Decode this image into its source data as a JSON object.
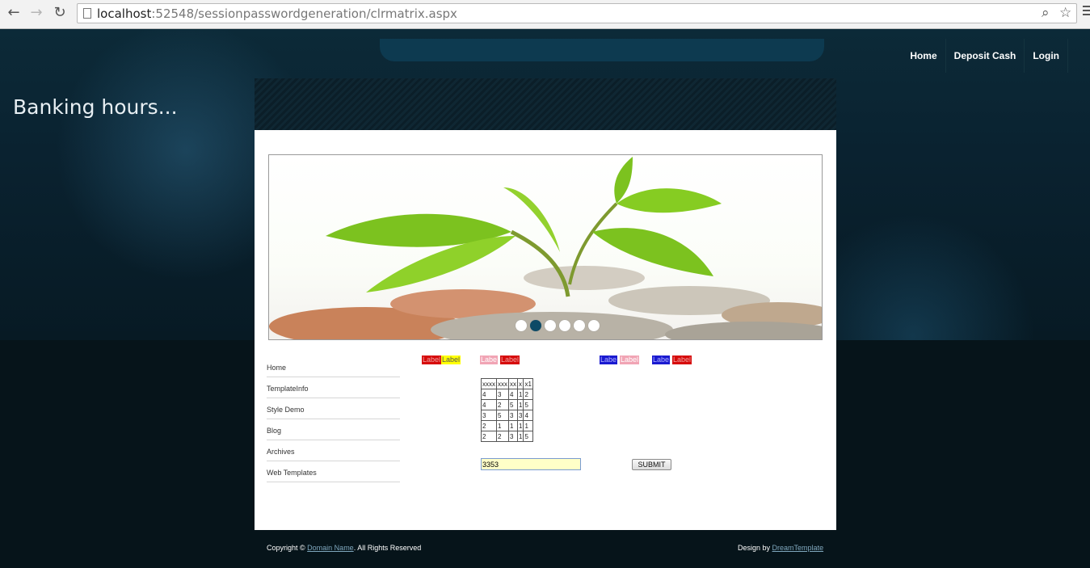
{
  "browser": {
    "back_icon": "back-arrow-icon",
    "forward_icon": "forward-arrow-icon",
    "reload_icon": "reload-icon",
    "url_host": "localhost",
    "url_path": ":52548/sessionpasswordgeneration/clrmatrix.aspx",
    "zoom_icon": "zoom-icon",
    "bookmark_icon": "star-icon",
    "menu_icon": "hamburger-menu-icon"
  },
  "header": {
    "nav": [
      "Home",
      "Deposit Cash",
      "Login"
    ],
    "tagline": "Banking hours..."
  },
  "slider": {
    "image": "plant sprouting from coins",
    "dots": 6,
    "active_dot": 1
  },
  "sidebar": {
    "items": [
      "Home",
      "TemplateInfo",
      "Style Demo",
      "Blog",
      "Archives",
      "Web Templates"
    ]
  },
  "color_labels": [
    {
      "text": "Label",
      "color": "#d60a0a"
    },
    {
      "text": "Label",
      "color": "#ffff00"
    },
    {
      "text": "Labe",
      "color": "#f1a4b4"
    },
    {
      "text": "Label",
      "color": "#d60a0a"
    },
    {
      "text": "Labe",
      "color": "#1a1ad0"
    },
    {
      "text": "Label",
      "color": "#f1a4b4"
    },
    {
      "text": "Labe",
      "color": "#1a1ad0"
    },
    {
      "text": "Label",
      "color": "#d60a0a"
    }
  ],
  "matrix": {
    "rows": [
      [
        "xxxx",
        "xxx",
        "xx",
        "x",
        "x1"
      ],
      [
        "4",
        "3",
        "4",
        "1",
        "2"
      ],
      [
        "4",
        "2",
        "5",
        "1",
        "5"
      ],
      [
        "3",
        "5",
        "3",
        "3",
        "4"
      ],
      [
        "2",
        "1",
        "1",
        "1",
        "1"
      ],
      [
        "2",
        "2",
        "3",
        "1",
        "5"
      ]
    ]
  },
  "form": {
    "code_value": "3353",
    "submit_label": "SUBMIT"
  },
  "footer": {
    "copyright_prefix": "Copyright ©",
    "domain_link": "Domain Name",
    "rights": ". All Rights Reserved",
    "design_by": "Design by",
    "designer_link": "DreamTemplate"
  }
}
